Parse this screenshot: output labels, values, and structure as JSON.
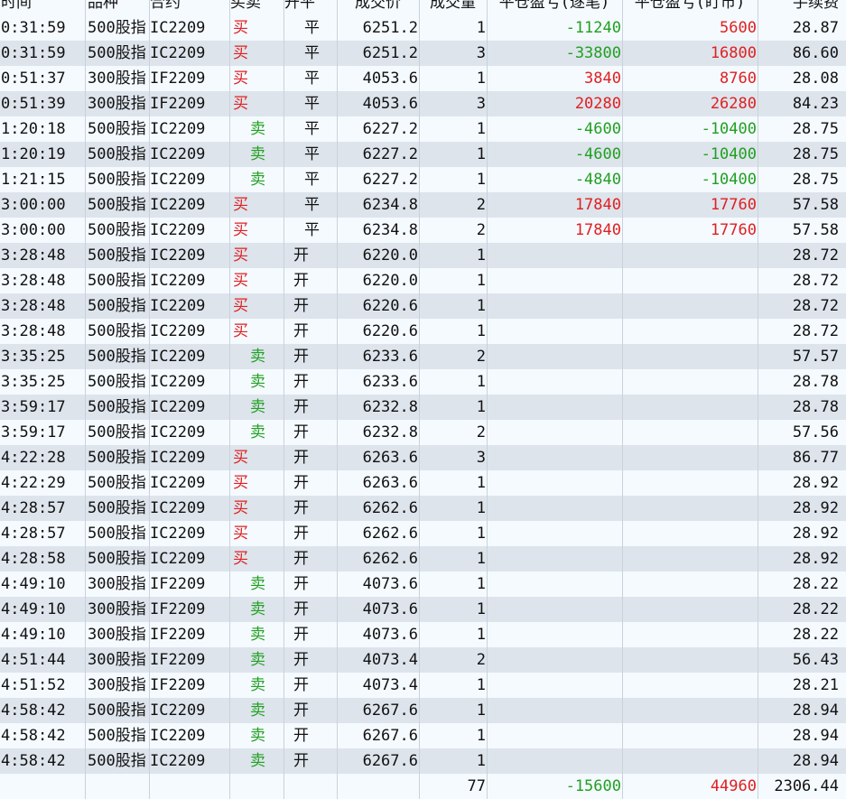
{
  "colors": {
    "buy": "#e02020",
    "sell": "#20a020",
    "alt_row": "#dde4ec",
    "row": "#f5faff"
  },
  "header": [
    "时间",
    "品种",
    "合约",
    "买卖",
    "开平",
    "成交价",
    "成交量",
    "平仓盈亏(逐笔)",
    "平仓盈亏(盯市)",
    "手续费"
  ],
  "rows": [
    {
      "time": "0:31:59",
      "product": "500股指",
      "contract": "IC2209",
      "side": "买",
      "oc": "平",
      "price": "6251.2",
      "qty": "1",
      "pnl_trade": "-11240",
      "pnl_mark": "5600",
      "fee": "28.87"
    },
    {
      "time": "0:31:59",
      "product": "500股指",
      "contract": "IC2209",
      "side": "买",
      "oc": "平",
      "price": "6251.2",
      "qty": "3",
      "pnl_trade": "-33800",
      "pnl_mark": "16800",
      "fee": "86.60"
    },
    {
      "time": "0:51:37",
      "product": "300股指",
      "contract": "IF2209",
      "side": "买",
      "oc": "平",
      "price": "4053.6",
      "qty": "1",
      "pnl_trade": "3840",
      "pnl_mark": "8760",
      "fee": "28.08"
    },
    {
      "time": "0:51:39",
      "product": "300股指",
      "contract": "IF2209",
      "side": "买",
      "oc": "平",
      "price": "4053.6",
      "qty": "3",
      "pnl_trade": "20280",
      "pnl_mark": "26280",
      "fee": "84.23"
    },
    {
      "time": "1:20:18",
      "product": "500股指",
      "contract": "IC2209",
      "side": "卖",
      "oc": "平",
      "price": "6227.2",
      "qty": "1",
      "pnl_trade": "-4600",
      "pnl_mark": "-10400",
      "fee": "28.75"
    },
    {
      "time": "1:20:19",
      "product": "500股指",
      "contract": "IC2209",
      "side": "卖",
      "oc": "平",
      "price": "6227.2",
      "qty": "1",
      "pnl_trade": "-4600",
      "pnl_mark": "-10400",
      "fee": "28.75"
    },
    {
      "time": "1:21:15",
      "product": "500股指",
      "contract": "IC2209",
      "side": "卖",
      "oc": "平",
      "price": "6227.2",
      "qty": "1",
      "pnl_trade": "-4840",
      "pnl_mark": "-10400",
      "fee": "28.75"
    },
    {
      "time": "3:00:00",
      "product": "500股指",
      "contract": "IC2209",
      "side": "买",
      "oc": "平",
      "price": "6234.8",
      "qty": "2",
      "pnl_trade": "17840",
      "pnl_mark": "17760",
      "fee": "57.58"
    },
    {
      "time": "3:00:00",
      "product": "500股指",
      "contract": "IC2209",
      "side": "买",
      "oc": "平",
      "price": "6234.8",
      "qty": "2",
      "pnl_trade": "17840",
      "pnl_mark": "17760",
      "fee": "57.58"
    },
    {
      "time": "3:28:48",
      "product": "500股指",
      "contract": "IC2209",
      "side": "买",
      "oc": "开",
      "price": "6220.0",
      "qty": "1",
      "pnl_trade": "",
      "pnl_mark": "",
      "fee": "28.72"
    },
    {
      "time": "3:28:48",
      "product": "500股指",
      "contract": "IC2209",
      "side": "买",
      "oc": "开",
      "price": "6220.0",
      "qty": "1",
      "pnl_trade": "",
      "pnl_mark": "",
      "fee": "28.72"
    },
    {
      "time": "3:28:48",
      "product": "500股指",
      "contract": "IC2209",
      "side": "买",
      "oc": "开",
      "price": "6220.6",
      "qty": "1",
      "pnl_trade": "",
      "pnl_mark": "",
      "fee": "28.72"
    },
    {
      "time": "3:28:48",
      "product": "500股指",
      "contract": "IC2209",
      "side": "买",
      "oc": "开",
      "price": "6220.6",
      "qty": "1",
      "pnl_trade": "",
      "pnl_mark": "",
      "fee": "28.72"
    },
    {
      "time": "3:35:25",
      "product": "500股指",
      "contract": "IC2209",
      "side": "卖",
      "oc": "开",
      "price": "6233.6",
      "qty": "2",
      "pnl_trade": "",
      "pnl_mark": "",
      "fee": "57.57"
    },
    {
      "time": "3:35:25",
      "product": "500股指",
      "contract": "IC2209",
      "side": "卖",
      "oc": "开",
      "price": "6233.6",
      "qty": "1",
      "pnl_trade": "",
      "pnl_mark": "",
      "fee": "28.78"
    },
    {
      "time": "3:59:17",
      "product": "500股指",
      "contract": "IC2209",
      "side": "卖",
      "oc": "开",
      "price": "6232.8",
      "qty": "1",
      "pnl_trade": "",
      "pnl_mark": "",
      "fee": "28.78"
    },
    {
      "time": "3:59:17",
      "product": "500股指",
      "contract": "IC2209",
      "side": "卖",
      "oc": "开",
      "price": "6232.8",
      "qty": "2",
      "pnl_trade": "",
      "pnl_mark": "",
      "fee": "57.56"
    },
    {
      "time": "4:22:28",
      "product": "500股指",
      "contract": "IC2209",
      "side": "买",
      "oc": "开",
      "price": "6263.6",
      "qty": "3",
      "pnl_trade": "",
      "pnl_mark": "",
      "fee": "86.77"
    },
    {
      "time": "4:22:29",
      "product": "500股指",
      "contract": "IC2209",
      "side": "买",
      "oc": "开",
      "price": "6263.6",
      "qty": "1",
      "pnl_trade": "",
      "pnl_mark": "",
      "fee": "28.92"
    },
    {
      "time": "4:28:57",
      "product": "500股指",
      "contract": "IC2209",
      "side": "买",
      "oc": "开",
      "price": "6262.6",
      "qty": "1",
      "pnl_trade": "",
      "pnl_mark": "",
      "fee": "28.92"
    },
    {
      "time": "4:28:57",
      "product": "500股指",
      "contract": "IC2209",
      "side": "买",
      "oc": "开",
      "price": "6262.6",
      "qty": "1",
      "pnl_trade": "",
      "pnl_mark": "",
      "fee": "28.92"
    },
    {
      "time": "4:28:58",
      "product": "500股指",
      "contract": "IC2209",
      "side": "买",
      "oc": "开",
      "price": "6262.6",
      "qty": "1",
      "pnl_trade": "",
      "pnl_mark": "",
      "fee": "28.92"
    },
    {
      "time": "4:49:10",
      "product": "300股指",
      "contract": "IF2209",
      "side": "卖",
      "oc": "开",
      "price": "4073.6",
      "qty": "1",
      "pnl_trade": "",
      "pnl_mark": "",
      "fee": "28.22"
    },
    {
      "time": "4:49:10",
      "product": "300股指",
      "contract": "IF2209",
      "side": "卖",
      "oc": "开",
      "price": "4073.6",
      "qty": "1",
      "pnl_trade": "",
      "pnl_mark": "",
      "fee": "28.22"
    },
    {
      "time": "4:49:10",
      "product": "300股指",
      "contract": "IF2209",
      "side": "卖",
      "oc": "开",
      "price": "4073.6",
      "qty": "1",
      "pnl_trade": "",
      "pnl_mark": "",
      "fee": "28.22"
    },
    {
      "time": "4:51:44",
      "product": "300股指",
      "contract": "IF2209",
      "side": "卖",
      "oc": "开",
      "price": "4073.4",
      "qty": "2",
      "pnl_trade": "",
      "pnl_mark": "",
      "fee": "56.43"
    },
    {
      "time": "4:51:52",
      "product": "300股指",
      "contract": "IF2209",
      "side": "卖",
      "oc": "开",
      "price": "4073.4",
      "qty": "1",
      "pnl_trade": "",
      "pnl_mark": "",
      "fee": "28.21"
    },
    {
      "time": "4:58:42",
      "product": "500股指",
      "contract": "IC2209",
      "side": "卖",
      "oc": "开",
      "price": "6267.6",
      "qty": "1",
      "pnl_trade": "",
      "pnl_mark": "",
      "fee": "28.94"
    },
    {
      "time": "4:58:42",
      "product": "500股指",
      "contract": "IC2209",
      "side": "卖",
      "oc": "开",
      "price": "6267.6",
      "qty": "1",
      "pnl_trade": "",
      "pnl_mark": "",
      "fee": "28.94"
    },
    {
      "time": "4:58:42",
      "product": "500股指",
      "contract": "IC2209",
      "side": "卖",
      "oc": "开",
      "price": "6267.6",
      "qty": "1",
      "pnl_trade": "",
      "pnl_mark": "",
      "fee": "28.94"
    }
  ],
  "totals": {
    "qty": "77",
    "pnl_trade": "-15600",
    "pnl_mark": "44960",
    "fee": "2306.44"
  }
}
